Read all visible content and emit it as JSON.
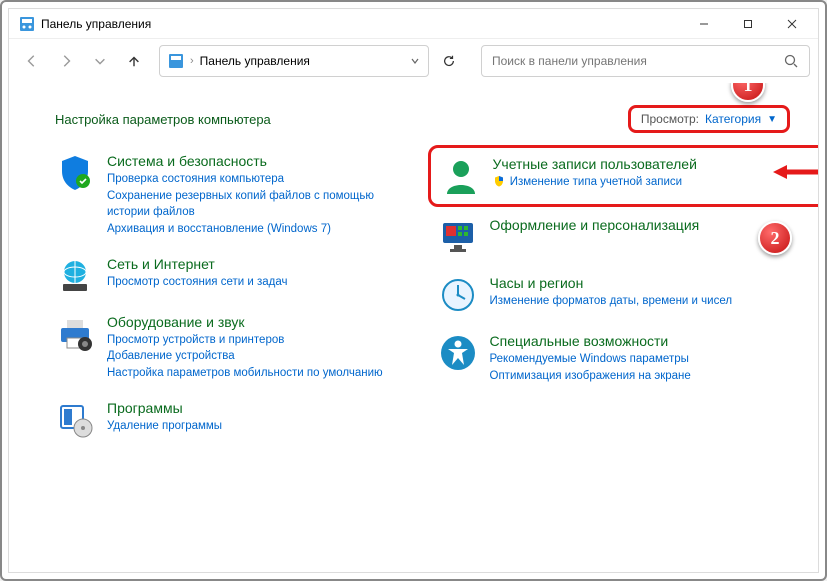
{
  "window": {
    "title": "Панель управления"
  },
  "nav": {
    "breadcrumb_sep": "›",
    "breadcrumb": "Панель управления",
    "search_placeholder": "Поиск в панели управления"
  },
  "header": {
    "title": "Настройка параметров компьютера",
    "view_label": "Просмотр:",
    "view_value": "Категория"
  },
  "left": [
    {
      "title": "Система и безопасность",
      "links": [
        "Проверка состояния компьютера",
        "Сохранение резервных копий файлов с помощью истории файлов",
        "Архивация и восстановление (Windows 7)"
      ]
    },
    {
      "title": "Сеть и Интернет",
      "links": [
        "Просмотр состояния сети и задач"
      ]
    },
    {
      "title": "Оборудование и звук",
      "links": [
        "Просмотр устройств и принтеров",
        "Добавление устройства",
        "Настройка параметров мобильности по умолчанию"
      ]
    },
    {
      "title": "Программы",
      "links": [
        "Удаление программы"
      ]
    }
  ],
  "right": [
    {
      "title": "Учетные записи пользователей",
      "links": [
        "Изменение типа учетной записи"
      ],
      "shield": true
    },
    {
      "title": "Оформление и персонализация",
      "links": []
    },
    {
      "title": "Часы и регион",
      "links": [
        "Изменение форматов даты, времени и чисел"
      ]
    },
    {
      "title": "Специальные возможности",
      "links": [
        "Рекомендуемые Windows параметры",
        "Оптимизация изображения на экране"
      ]
    }
  ],
  "badges": {
    "one": "1",
    "two": "2"
  }
}
